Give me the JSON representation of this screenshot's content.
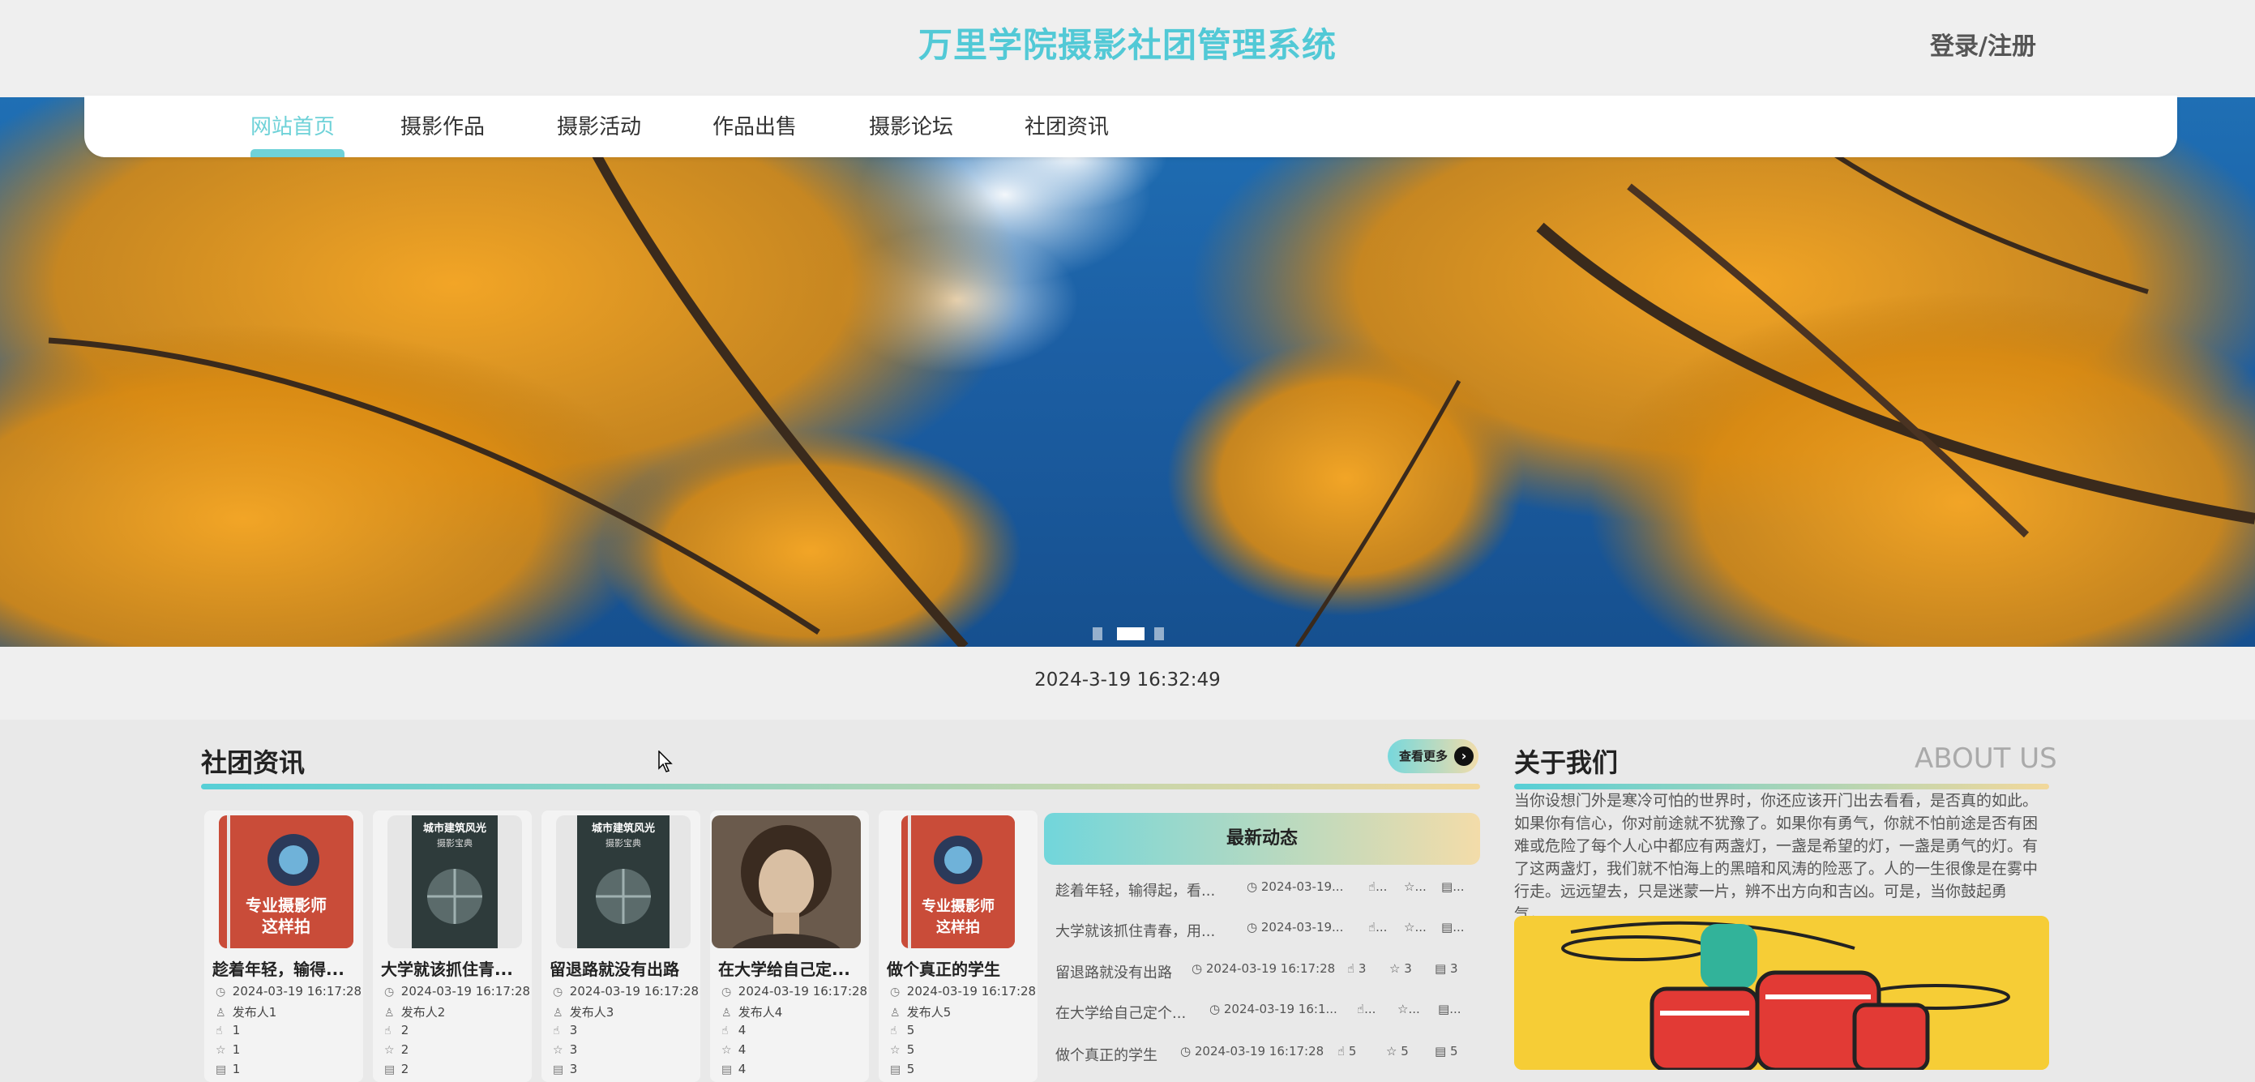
{
  "header": {
    "site_title": "万里学院摄影社团管理系统",
    "login_label": "登录/注册"
  },
  "nav": {
    "items": [
      {
        "label": "网站首页",
        "active": true
      },
      {
        "label": "摄影作品"
      },
      {
        "label": "摄影活动"
      },
      {
        "label": "作品出售"
      },
      {
        "label": "摄影论坛"
      },
      {
        "label": "社团资讯"
      }
    ]
  },
  "banner": {
    "slides": 3,
    "active_slide": 2
  },
  "datetime": "2024-3-19 16:32:49",
  "news": {
    "title": "社团资讯",
    "more_label": "查看更多",
    "cards": [
      {
        "title": "趁着年轻，输得...",
        "time": "2024-03-19 16:17:28",
        "publisher": "发布人1",
        "likes": "1",
        "favorites": "1",
        "views": "1",
        "cover": "book-red"
      },
      {
        "title": "大学就该抓住青...",
        "time": "2024-03-19 16:17:28",
        "publisher": "发布人2",
        "likes": "2",
        "favorites": "2",
        "views": "2",
        "cover": "book-dark"
      },
      {
        "title": "留退路就没有出路",
        "time": "2024-03-19 16:17:28",
        "publisher": "发布人3",
        "likes": "3",
        "favorites": "3",
        "views": "3",
        "cover": "book-dark"
      },
      {
        "title": "在大学给自己定...",
        "time": "2024-03-19 16:17:28",
        "publisher": "发布人4",
        "likes": "4",
        "favorites": "4",
        "views": "4",
        "cover": "portrait"
      },
      {
        "title": "做个真正的学生",
        "time": "2024-03-19 16:17:28",
        "publisher": "发布人5",
        "likes": "5",
        "favorites": "5",
        "views": "5",
        "cover": "book-red"
      }
    ],
    "cover_texts": {
      "red_line1": "专业摄影师",
      "red_line2": "这样拍",
      "dark_line1": "城市建筑风光",
      "dark_line2": "摄影宝典"
    }
  },
  "latest": {
    "title": "最新动态",
    "rows": [
      {
        "title": "趁着年轻，输得起，看...",
        "time": "2024-03-19...",
        "likes": "...",
        "favorites": "...",
        "views": "..."
      },
      {
        "title": "大学就该抓住青春，用...",
        "time": "2024-03-19...",
        "likes": "...",
        "favorites": "...",
        "views": "..."
      },
      {
        "title": "留退路就没有出路",
        "time": "2024-03-19 16:17:28",
        "likes": "3",
        "favorites": "3",
        "views": "3"
      },
      {
        "title": "在大学给自己定个...",
        "time": "2024-03-19 16:1...",
        "likes": "...",
        "favorites": "...",
        "views": "..."
      },
      {
        "title": "做个真正的学生",
        "time": "2024-03-19 16:17:28",
        "likes": "5",
        "favorites": "5",
        "views": "5"
      }
    ]
  },
  "about": {
    "title": "关于我们",
    "title_en": "ABOUT US",
    "text": "当你设想门外是寒冷可怕的世界时，你还应该开门出去看看，是否真的如此。如果你有信心，你对前途就不犹豫了。如果你有勇气，你就不怕前途是否有困难或危险了每个人心中都应有两盏灯，一盏是希望的灯，一盏是勇气的灯。有了这两盏灯，我们就不怕海上的黑暗和风涛的险恶了。人的一生很像是在雾中行走。远远望去，只是迷蒙一片，辨不出方向和吉凶。可是，当你鼓起勇气，..."
  },
  "colors": {
    "accent": "#6fd2d8",
    "gradient_end": "#f2d89b",
    "title": "#52c9d6"
  }
}
